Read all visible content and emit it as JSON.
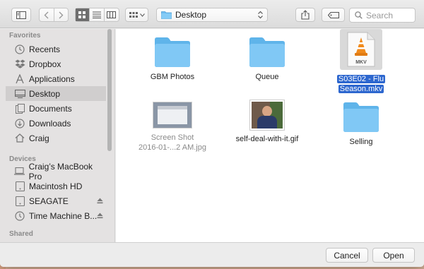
{
  "toolbar": {
    "location": "Desktop",
    "search_placeholder": "Search"
  },
  "sidebar": {
    "favorites_heading": "Favorites",
    "favorites": [
      {
        "label": "Recents",
        "icon": "clock-icon"
      },
      {
        "label": "Dropbox",
        "icon": "dropbox-icon"
      },
      {
        "label": "Applications",
        "icon": "applications-icon"
      },
      {
        "label": "Desktop",
        "icon": "desktop-icon",
        "selected": true
      },
      {
        "label": "Documents",
        "icon": "documents-icon"
      },
      {
        "label": "Downloads",
        "icon": "downloads-icon"
      },
      {
        "label": "Craig",
        "icon": "home-icon"
      }
    ],
    "devices_heading": "Devices",
    "devices": [
      {
        "label": "Craig’s MacBook Pro",
        "icon": "laptop-icon"
      },
      {
        "label": "Macintosh HD",
        "icon": "disk-icon"
      },
      {
        "label": "SEAGATE",
        "icon": "disk-icon",
        "eject": true
      },
      {
        "label": "Time Machine B...",
        "icon": "time-machine-icon",
        "eject": true
      }
    ],
    "shared_heading": "Shared"
  },
  "files": [
    {
      "name": "GBM Photos",
      "kind": "folder"
    },
    {
      "name": "Queue",
      "kind": "folder"
    },
    {
      "name_line1": "S03E02 - Flu",
      "name_line2": "Season.mkv",
      "kind": "mkv",
      "badge": "MKV",
      "selected": true
    },
    {
      "name_line1": "Screen Shot",
      "name_line2": "2016-01-...2 AM.jpg",
      "kind": "screenshot",
      "dimmed": true
    },
    {
      "name": "self-deal-with-it.gif",
      "kind": "photo"
    },
    {
      "name": "Selling",
      "kind": "folder"
    }
  ],
  "buttons": {
    "cancel": "Cancel",
    "open": "Open"
  },
  "colors": {
    "folder": "#79c6f4",
    "selection": "#2d67cf",
    "vlc_orange": "#f08a1c"
  }
}
